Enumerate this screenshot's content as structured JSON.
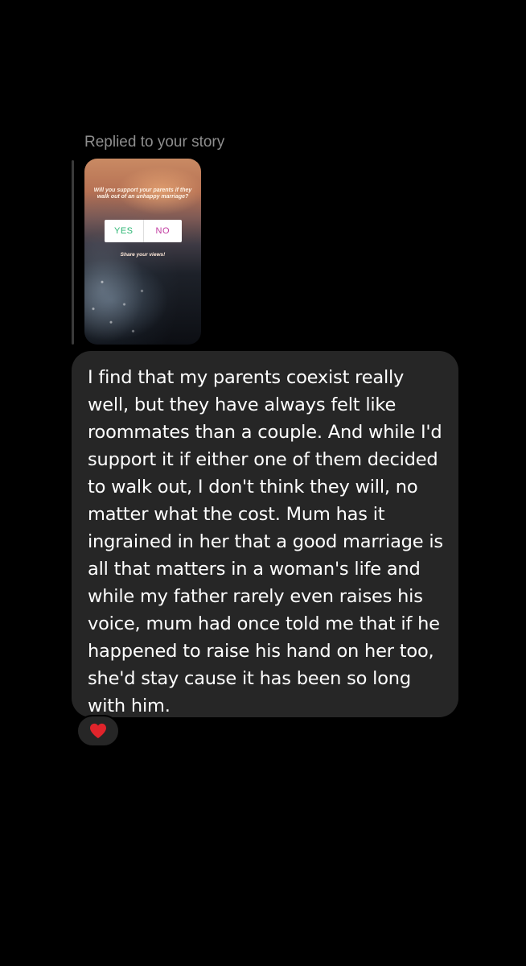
{
  "reply": {
    "label": "Replied to your story"
  },
  "story": {
    "question": "Will you support your parents if they walk out of an unhappy marriage?",
    "poll_yes": "YES",
    "poll_no": "NO",
    "hint": "Share your views!"
  },
  "message": {
    "text": "I find that my parents coexist really well, but they have always felt like roommates than a couple. And while I'd support it if either one of them decided to walk out, I don't think they will, no matter what the cost. Mum has it ingrained in her that a good marriage is all that matters in a woman's life and while my father rarely even raises his voice, mum had once told me that if he happened to raise his hand on her too, she'd stay cause it has been so long with him."
  },
  "reaction": {
    "icon": "heart-icon",
    "color": "#e0242b"
  },
  "colors": {
    "background": "#000000",
    "bubble": "#262626",
    "label": "#8e8e8e"
  }
}
